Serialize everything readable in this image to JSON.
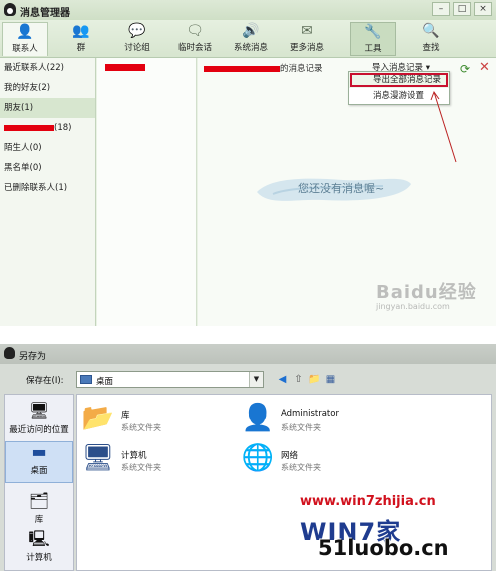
{
  "message_manager": {
    "title": "消息管理器",
    "toolbar": [
      "联系人",
      "群",
      "讨论组",
      "临时会话",
      "系统消息",
      "更多消息",
      "工具",
      "查找"
    ],
    "sidebar": [
      "最近联系人(22)",
      "我的好友(2)",
      "朋友(1)",
      "(18)",
      "陌生人(0)",
      "黑名单(0)",
      "已删除联系人(1)"
    ],
    "breadcrumb": "的消息记录",
    "menu_button": "导入消息记录",
    "menu_items": [
      "导出全部消息记录",
      "消息漫游设置"
    ],
    "empty_text": "您还没有消息喔~",
    "watermark": "Baidu经验",
    "watermark_sub": "jingyan.baidu.com"
  },
  "save_as": {
    "title": "另存为",
    "save_in_label": "保存在(I):",
    "location": "桌面",
    "places": [
      "最近访问的位置",
      "桌面",
      "库",
      "计算机"
    ],
    "files": [
      {
        "name": "库",
        "type": "系统文件夹",
        "icon": "library-icon"
      },
      {
        "name": "Administrator",
        "type": "系统文件夹",
        "icon": "user-folder-icon"
      },
      {
        "name": "计算机",
        "type": "系统文件夹",
        "icon": "computer-icon"
      },
      {
        "name": "网络",
        "type": "系统文件夹",
        "icon": "network-icon"
      }
    ]
  },
  "site_watermark": {
    "url": "www.win7zhijia.cn",
    "logo": "WIN7家",
    "url2": "51luobo.cn"
  },
  "colors": {
    "highlight_red": "#c8102e",
    "redaction": "#e3000f",
    "window_green": "#e9f2e4",
    "dialog_gray": "#d7dcd6"
  }
}
